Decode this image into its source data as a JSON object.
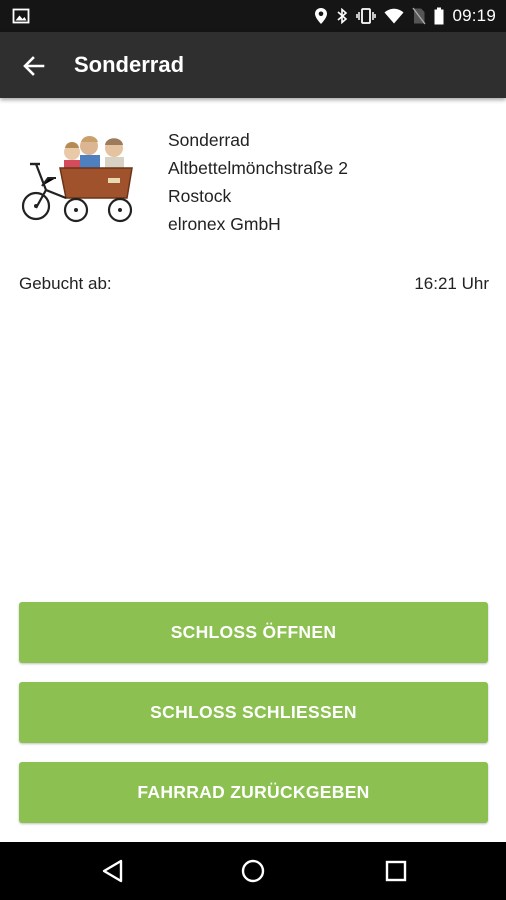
{
  "status_bar": {
    "time": "09:19",
    "icons": [
      "image-icon",
      "location-icon",
      "bluetooth-icon",
      "vibrate-icon",
      "wifi-icon",
      "no-sim-icon",
      "battery-icon"
    ]
  },
  "app_bar": {
    "title": "Sonderrad",
    "back_icon": "arrow-back-icon"
  },
  "bike": {
    "name": "Sonderrad",
    "street": "Altbettelmönchstraße 2",
    "city": "Rostock",
    "company": "elronex GmbH"
  },
  "booking": {
    "label": "Gebucht ab:",
    "time": "16:21 Uhr"
  },
  "buttons": {
    "open_lock": "SCHLOSS ÖFFNEN",
    "close_lock": "SCHLOSS SCHLIESSEN",
    "return_bike": "FAHRRAD ZURÜCKGEBEN"
  },
  "colors": {
    "accent_green": "#8cc152",
    "app_bar": "#2f2f2f",
    "status_bar": "#151515",
    "nav_bar": "#000000"
  },
  "nav_bar": {
    "icons": [
      "nav-back-icon",
      "nav-home-icon",
      "nav-recent-icon"
    ]
  }
}
